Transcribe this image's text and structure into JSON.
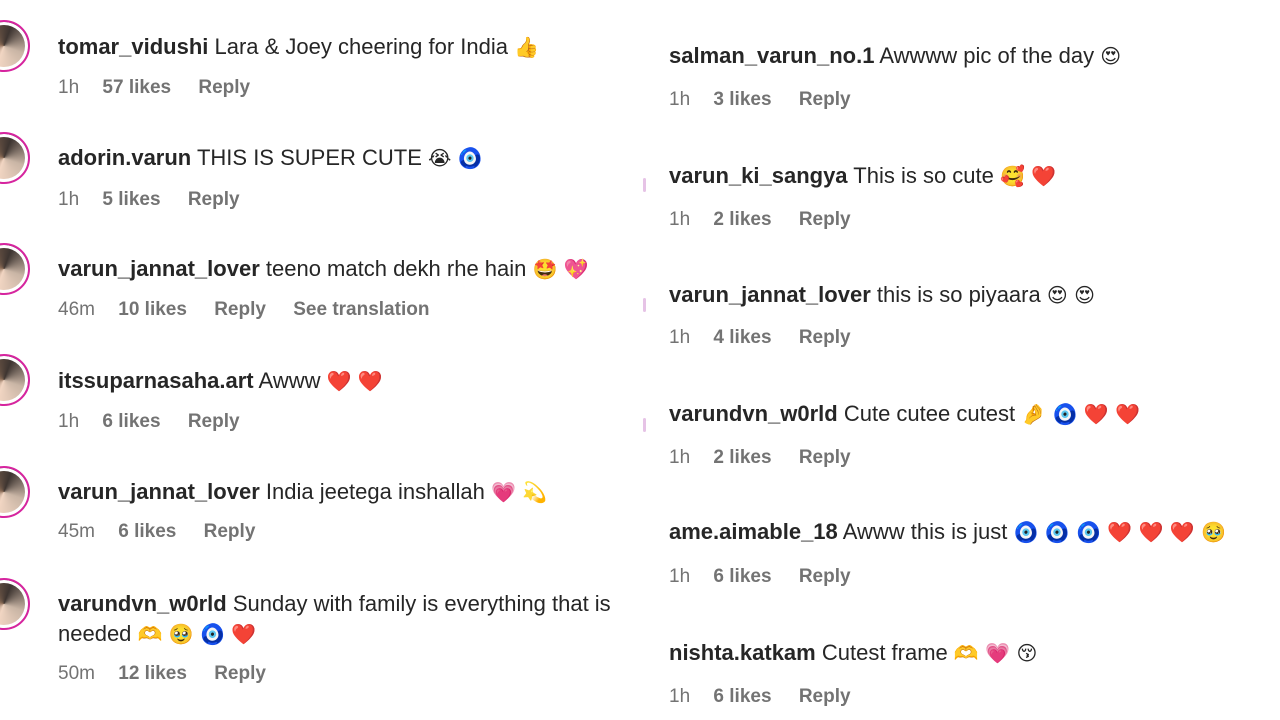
{
  "left_comments": [
    {
      "username": "tomar_vidushi",
      "text": "Lara & Joey cheering for India",
      "emoji": "👍",
      "time": "1h",
      "likes": "57 likes",
      "reply": "Reply"
    },
    {
      "username": "adorin.varun",
      "text": "THIS IS SUPER CUTE",
      "emoji": "😭 🧿",
      "time": "1h",
      "likes": "5 likes",
      "reply": "Reply"
    },
    {
      "username": "varun_jannat_lover",
      "text": "teeno match dekh rhe hain",
      "emoji": "🤩 💖",
      "time": "46m",
      "likes": "10 likes",
      "reply": "Reply",
      "translation": "See translation"
    },
    {
      "username": "itssuparnasaha.art",
      "text": "Awww",
      "emoji": "❤️ ❤️",
      "time": "1h",
      "likes": "6 likes",
      "reply": "Reply"
    },
    {
      "username": "varun_jannat_lover",
      "text": "India jeetega inshallah",
      "emoji": "💗 💫",
      "time": "45m",
      "likes": "6 likes",
      "reply": "Reply"
    },
    {
      "username": "varundvn_w0rld",
      "text": "Sunday with family is everything that is needed",
      "emoji": "🫶 🥹 🧿 ❤️",
      "time": "50m",
      "likes": "12 likes",
      "reply": "Reply"
    }
  ],
  "right_comments": [
    {
      "username": "salman_varun_no.1",
      "text": "Awwww pic of the day",
      "emoji": "😍",
      "time": "1h",
      "likes": "3 likes",
      "reply": "Reply"
    },
    {
      "username": "varun_ki_sangya",
      "text": "This is so cute",
      "emoji": "🥰 ❤️",
      "time": "1h",
      "likes": "2 likes",
      "reply": "Reply"
    },
    {
      "username": "varun_jannat_lover",
      "text": "this is so piyaara",
      "emoji": "😍 😍",
      "time": "1h",
      "likes": "4 likes",
      "reply": "Reply"
    },
    {
      "username": "varundvn_w0rld",
      "text": "Cute cutee cutest",
      "emoji": "🤌 🧿 ❤️ ❤️",
      "time": "1h",
      "likes": "2 likes",
      "reply": "Reply"
    },
    {
      "username": "ame.aimable_18",
      "text": "Awww this is just",
      "emoji": "🧿 🧿 🧿 ❤️ ❤️ ❤️ 🥹",
      "time": "1h",
      "likes": "6 likes",
      "reply": "Reply"
    },
    {
      "username": "nishta.katkam",
      "text": "Cutest frame",
      "emoji": "🫶 💗 😚",
      "time": "1h",
      "likes": "6 likes",
      "reply": "Reply"
    }
  ]
}
